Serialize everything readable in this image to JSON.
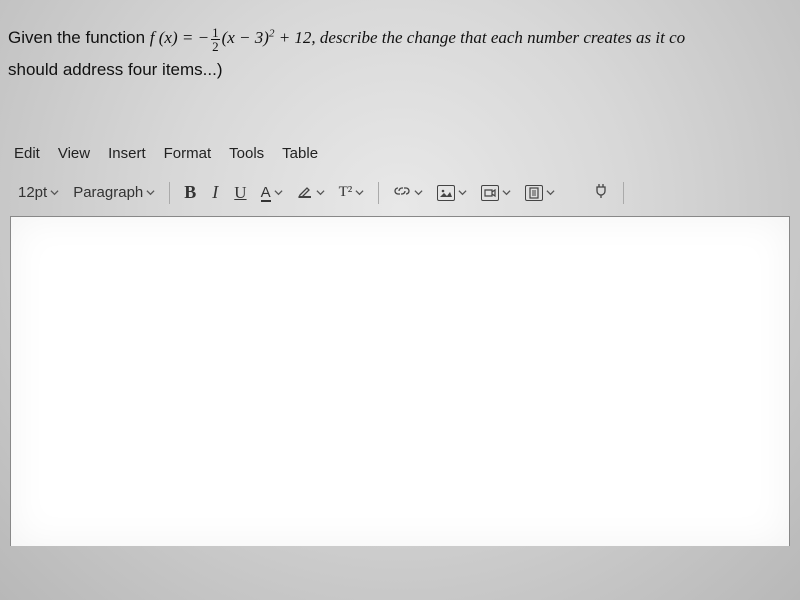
{
  "question": {
    "prefix": "Given the function ",
    "fn": "f",
    "arg_open": " (",
    "var": "x",
    "arg_close": ") = −",
    "frac_num": "1",
    "frac_den": "2",
    "paren_open": "(",
    "inner": "x − 3",
    "paren_close": ")",
    "exp": "2",
    "tail1": " + 12, describe the change that each number creates as it co",
    "line2": "should address four items...)"
  },
  "menubar": [
    "Edit",
    "View",
    "Insert",
    "Format",
    "Tools",
    "Table"
  ],
  "toolbar": {
    "font_size": "12pt",
    "style": "Paragraph",
    "bold": "B",
    "italic": "I",
    "underline": "U",
    "text_color": "A",
    "superscript": "T²"
  }
}
